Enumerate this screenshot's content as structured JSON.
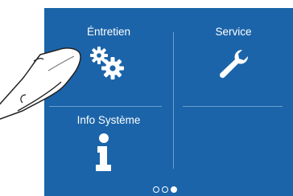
{
  "tiles": {
    "entretien": {
      "label": "Éntretien",
      "icon": "gears-icon"
    },
    "service": {
      "label": "Service",
      "icon": "wrench-icon"
    },
    "info": {
      "label": "Info Système",
      "icon": "info-icon"
    }
  },
  "pagination": {
    "pages": 3,
    "active": 3
  },
  "colors": {
    "background": "#1b64a9",
    "foreground": "#ffffff",
    "divider": "#6a9fd0"
  },
  "overlay": {
    "icon": "pointing-hand-icon"
  }
}
